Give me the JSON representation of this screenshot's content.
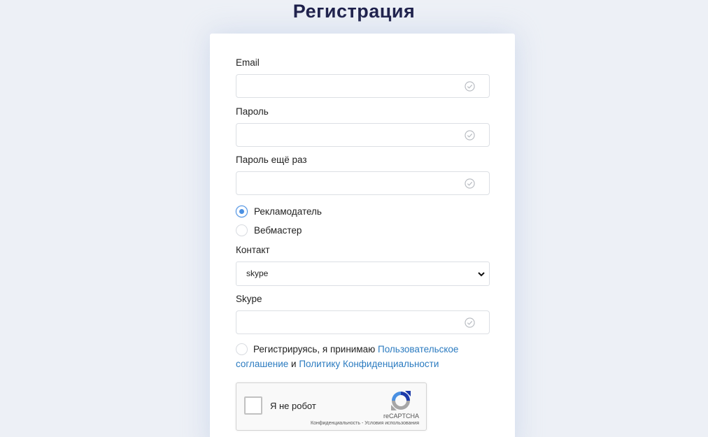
{
  "page_title": "Регистрация",
  "form": {
    "email": {
      "label": "Email",
      "value": "",
      "placeholder": ""
    },
    "password": {
      "label": "Пароль",
      "value": "",
      "placeholder": ""
    },
    "password_repeat": {
      "label": "Пароль ещё раз",
      "value": "",
      "placeholder": ""
    },
    "role_options": [
      {
        "label": "Рекламодатель",
        "checked": true
      },
      {
        "label": "Вебмастер",
        "checked": false
      }
    ],
    "contact": {
      "label": "Контакт",
      "selected": "skype"
    },
    "skype": {
      "label": "Skype",
      "value": "",
      "placeholder": ""
    },
    "agreement": {
      "prefix": "Регистрируясь, я принимаю",
      "link1_part1": "Пользовательское",
      "link1_part2": "соглашение",
      "conjunction": "и",
      "link2": "Политику Конфиденциальности"
    }
  },
  "recaptcha": {
    "label": "Я не робот",
    "brand": "reCAPTCHA",
    "privacy": "Конфиденциальность",
    "separator": "-",
    "terms": "Условия использования"
  },
  "colors": {
    "accent": "#4a90e2",
    "link": "#2b7bc0",
    "title": "#1d1f4a",
    "background": "#edf0f6"
  }
}
